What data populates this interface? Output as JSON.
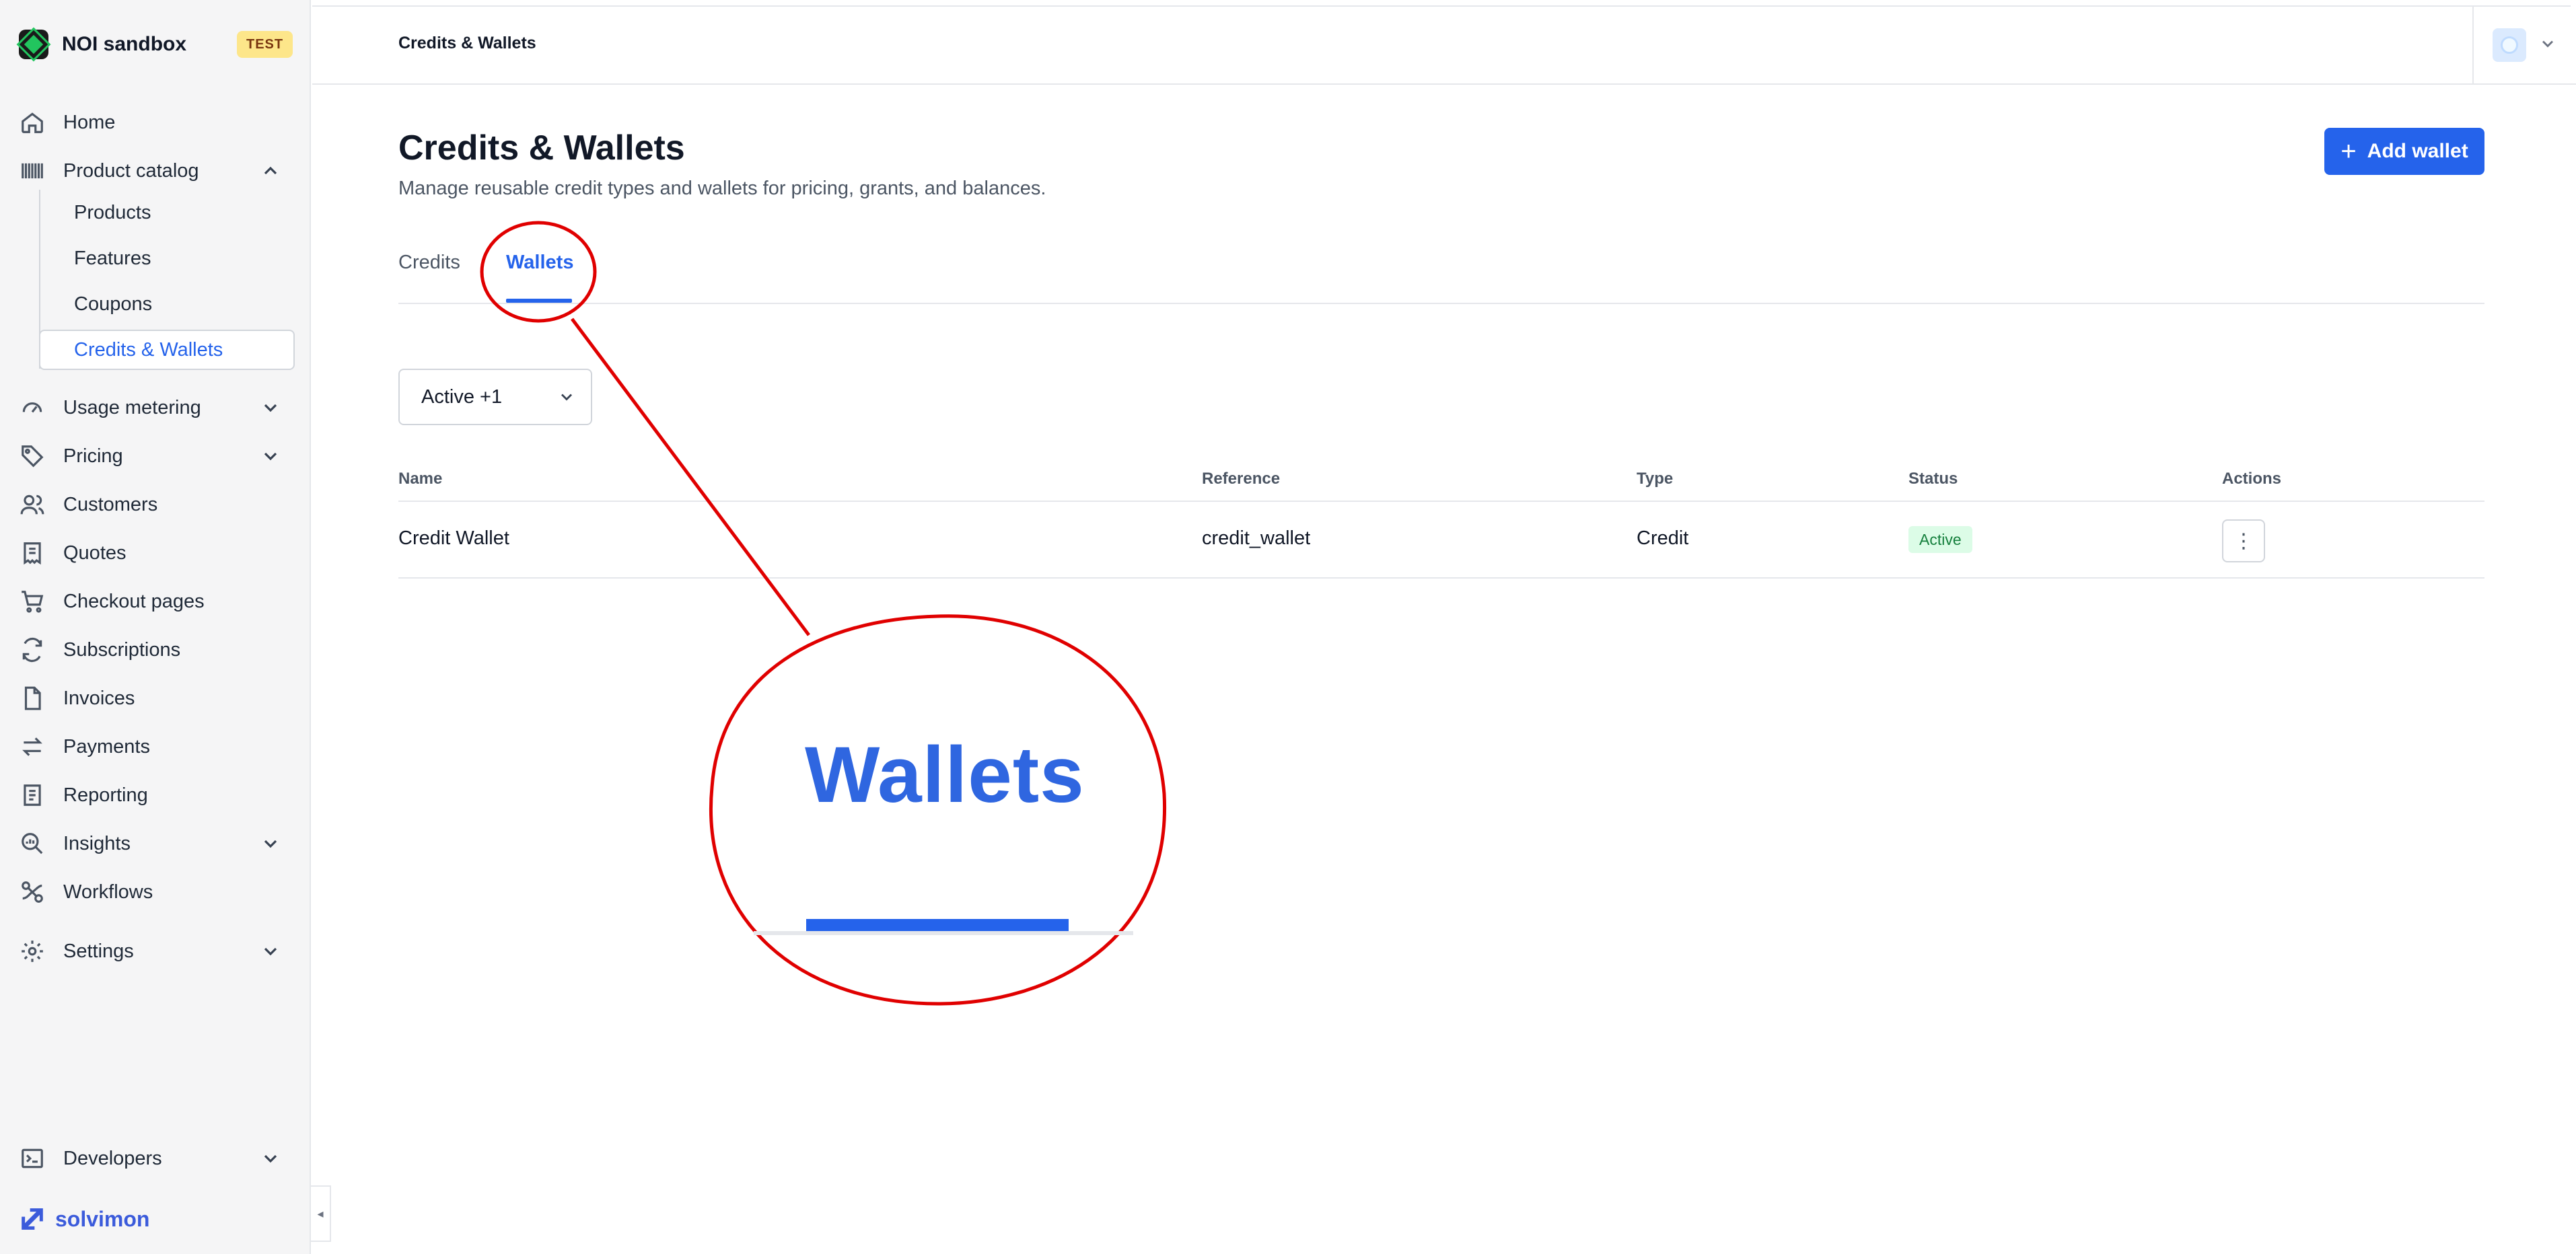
{
  "sidebar": {
    "brand": {
      "name": "NOI sandbox",
      "badge": "TEST"
    },
    "nav": {
      "home": "Home",
      "product_catalog": "Product catalog",
      "usage_metering": "Usage metering",
      "pricing": "Pricing",
      "customers": "Customers",
      "quotes": "Quotes",
      "checkout_pages": "Checkout pages",
      "subscriptions": "Subscriptions",
      "invoices": "Invoices",
      "payments": "Payments",
      "reporting": "Reporting",
      "insights": "Insights",
      "workflows": "Workflows",
      "settings": "Settings",
      "developers": "Developers"
    },
    "product_catalog_items": {
      "products": "Products",
      "features": "Features",
      "coupons": "Coupons",
      "credits_wallets": "Credits & Wallets"
    },
    "footer_brand": "solvimon"
  },
  "header": {
    "breadcrumb": "Credits & Wallets"
  },
  "main": {
    "title": "Credits & Wallets",
    "subtitle": "Manage reusable credit types and wallets for pricing, grants, and balances.",
    "add_button": "Add wallet",
    "tabs": {
      "credits": "Credits",
      "wallets": "Wallets"
    },
    "filter_value": "Active +1",
    "table": {
      "columns": {
        "name": "Name",
        "reference": "Reference",
        "type": "Type",
        "status": "Status",
        "actions": "Actions"
      },
      "rows": [
        {
          "name": "Credit Wallet",
          "reference": "credit_wallet",
          "type": "Credit",
          "status": "Active"
        }
      ]
    }
  },
  "annotation": {
    "zoom_label": "Wallets"
  },
  "colors": {
    "accent": "#2563eb",
    "annotation": "#e00000",
    "status_active_bg": "#dcfce7",
    "status_active_text": "#15803d",
    "test_badge": "#fde68a"
  }
}
